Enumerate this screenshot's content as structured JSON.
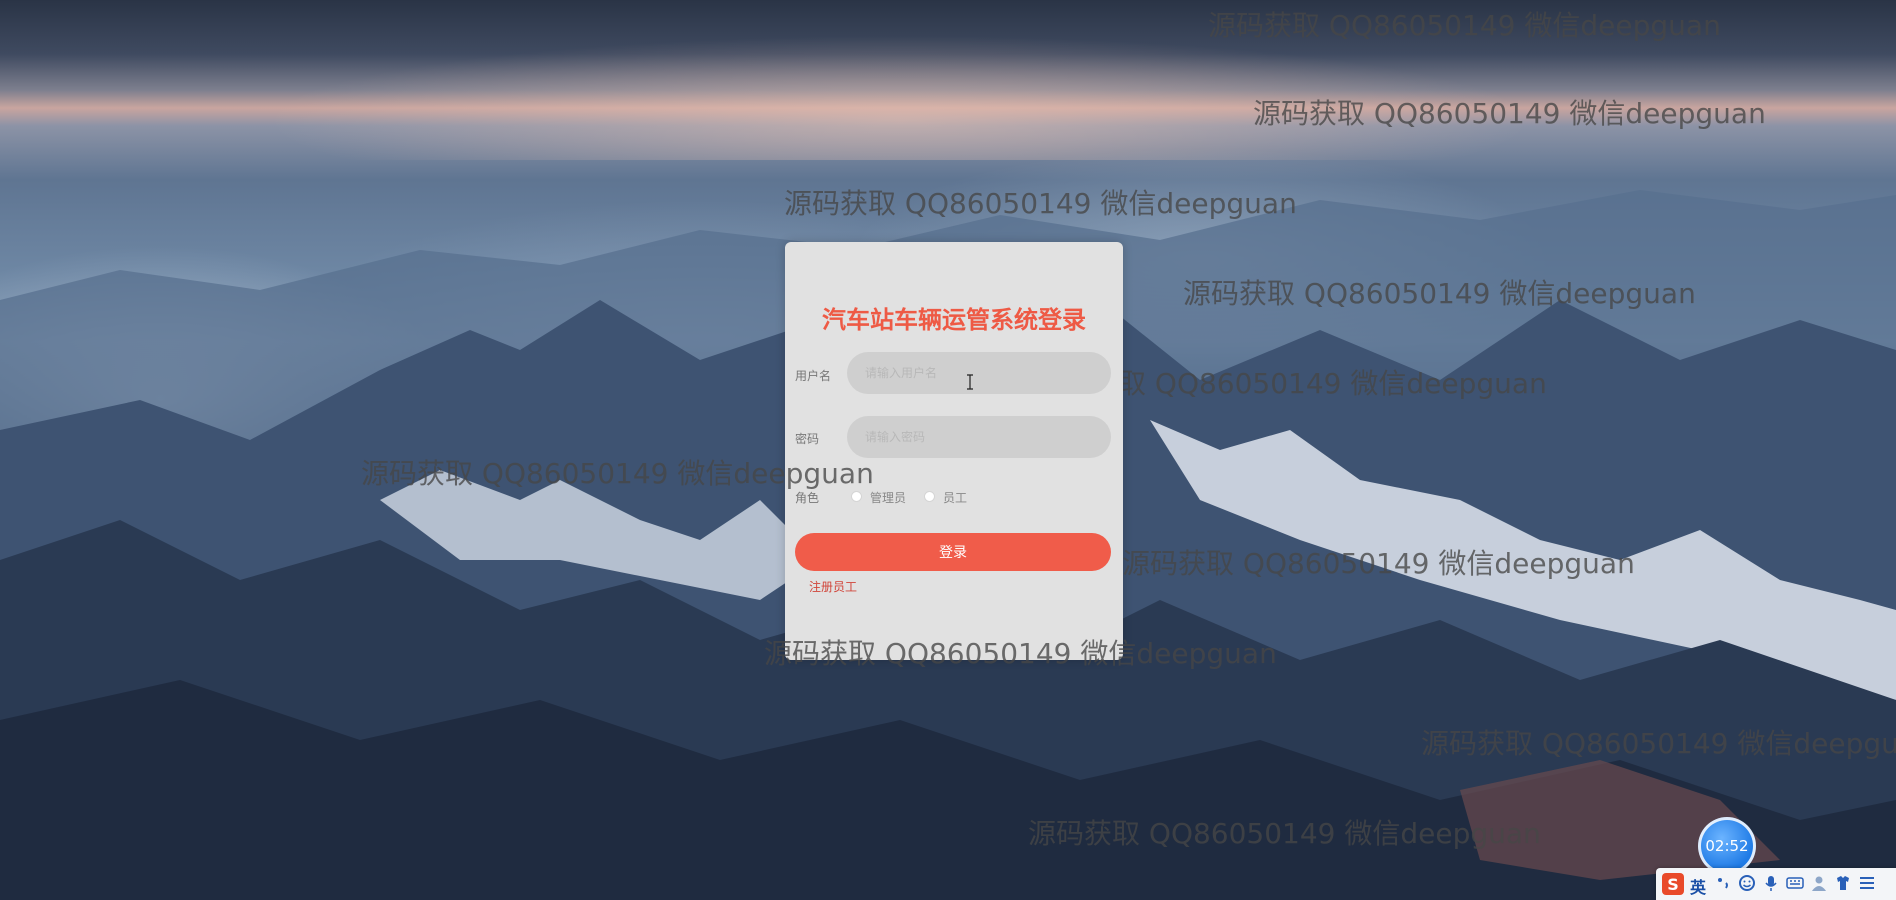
{
  "watermarks": [
    "源码获取 QQ86050149 微信deepguan",
    "源码获取 QQ86050149 微信deepguan",
    "源码获取 QQ86050149 微信deepguan",
    "源码获取 QQ86050149 微信deepguan",
    "源码获取 QQ86050149 微信deepguan",
    "源码获取 QQ86050149 微信deepguan",
    "源码获取 QQ86050149 微信deepguan",
    "源码获取 QQ86050149 微信deepguan",
    "源码获取 QQ86050149 微信deepgu",
    "源码获取 QQ86050149 微信deepguan"
  ],
  "login": {
    "title": "汽车站车辆运管系统登录",
    "username_label": "用户名",
    "username_placeholder": "请输入用户名",
    "password_label": "密码",
    "password_placeholder": "请输入密码",
    "role_label": "角色",
    "roles": [
      "管理员",
      "员工"
    ],
    "submit_label": "登录",
    "register_label": "注册员工"
  },
  "colors": {
    "accent": "#f05c4a",
    "title": "#ee5a45",
    "card_bg": "#e1e1e1",
    "input_bg": "#cfcfcf"
  },
  "overlay": {
    "clock_time": "02:52",
    "ime_logo": "S",
    "ime_lang": "英",
    "ime_icons": [
      "punctuation-icon",
      "emoji-icon",
      "microphone-icon",
      "keyboard-icon",
      "user-icon",
      "skin-icon",
      "menu-icon"
    ]
  }
}
